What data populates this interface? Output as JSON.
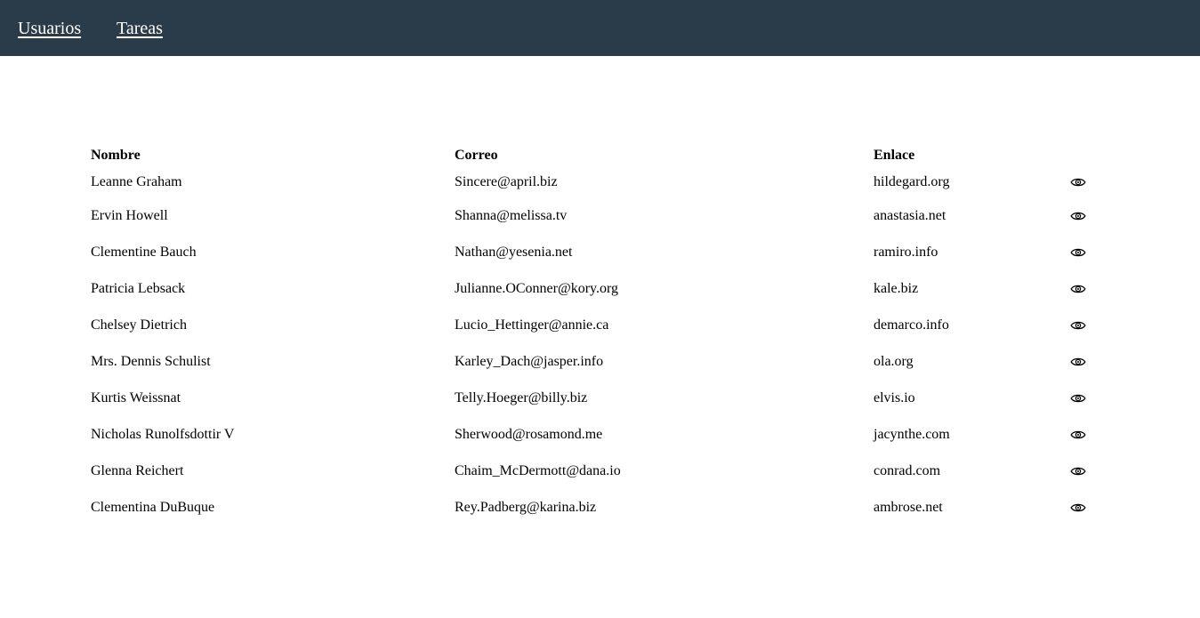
{
  "nav": {
    "items": [
      {
        "label": "Usuarios"
      },
      {
        "label": "Tareas"
      }
    ]
  },
  "table": {
    "headers": {
      "name": "Nombre",
      "email": "Correo",
      "link": "Enlace"
    },
    "action_icon": "eye-icon",
    "rows": [
      {
        "name": "Leanne Graham",
        "email": "Sincere@april.biz",
        "link": "hildegard.org"
      },
      {
        "name": "Ervin Howell",
        "email": "Shanna@melissa.tv",
        "link": "anastasia.net"
      },
      {
        "name": "Clementine Bauch",
        "email": "Nathan@yesenia.net",
        "link": "ramiro.info"
      },
      {
        "name": "Patricia Lebsack",
        "email": "Julianne.OConner@kory.org",
        "link": "kale.biz"
      },
      {
        "name": "Chelsey Dietrich",
        "email": "Lucio_Hettinger@annie.ca",
        "link": "demarco.info"
      },
      {
        "name": "Mrs. Dennis Schulist",
        "email": "Karley_Dach@jasper.info",
        "link": "ola.org"
      },
      {
        "name": "Kurtis Weissnat",
        "email": "Telly.Hoeger@billy.biz",
        "link": "elvis.io"
      },
      {
        "name": "Nicholas Runolfsdottir V",
        "email": "Sherwood@rosamond.me",
        "link": "jacynthe.com"
      },
      {
        "name": "Glenna Reichert",
        "email": "Chaim_McDermott@dana.io",
        "link": "conrad.com"
      },
      {
        "name": "Clementina DuBuque",
        "email": "Rey.Padberg@karina.biz",
        "link": "ambrose.net"
      }
    ]
  },
  "colors": {
    "navbar_bg": "#2a3b4a",
    "nav_text": "#ffffff",
    "page_bg": "#ffffff",
    "text": "#000000"
  }
}
